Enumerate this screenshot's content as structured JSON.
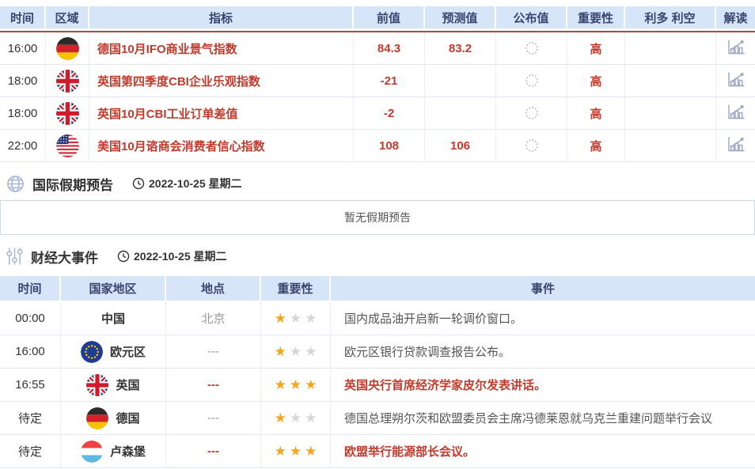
{
  "colors": {
    "accent_red": "#c23a2c",
    "header_bg": "#d7e5f8",
    "header_text": "#3b4470",
    "divider_red": "#a94a4a",
    "star_gold": "#f7a51d",
    "star_gray": "#d6d6d6"
  },
  "calendar_table": {
    "headers": [
      "时间",
      "区域",
      "指标",
      "前值",
      "预测值",
      "公布值",
      "重要性",
      "利多 利空",
      "解读"
    ],
    "rows": [
      {
        "time": "16:00",
        "flag": "germany",
        "indicator": "德国10月IFO商业景气指数",
        "previous": "84.3",
        "forecast": "83.2",
        "published": "",
        "importance": "高"
      },
      {
        "time": "18:00",
        "flag": "uk",
        "indicator": "英国第四季度CBI企业乐观指数",
        "previous": "-21",
        "forecast": "",
        "published": "",
        "importance": "高"
      },
      {
        "time": "18:00",
        "flag": "uk",
        "indicator": "英国10月CBI工业订单差值",
        "previous": "-2",
        "forecast": "",
        "published": "",
        "importance": "高"
      },
      {
        "time": "22:00",
        "flag": "usa",
        "indicator": "美国10月谘商会消费者信心指数",
        "previous": "108",
        "forecast": "106",
        "published": "",
        "importance": "高"
      }
    ]
  },
  "holiday_section": {
    "icon": "globe-icon",
    "title": "国际假期预告",
    "date_icon": "clock-icon",
    "date": "2022-10-25 星期二",
    "empty_message": "暂无假期预告"
  },
  "events_section": {
    "icon": "sliders-icon",
    "title": "财经大事件",
    "date_icon": "clock-icon",
    "date": "2022-10-25 星期二",
    "headers": [
      "时间",
      "国家地区",
      "地点",
      "重要性",
      "事件"
    ],
    "rows": [
      {
        "time": "00:00",
        "flag": "none",
        "country": "中国",
        "location": "北京",
        "stars": 1,
        "max_stars": 3,
        "event": "国内成品油开启新一轮调价窗口。",
        "highlight": false
      },
      {
        "time": "16:00",
        "flag": "eu",
        "country": "欧元区",
        "location": "---",
        "stars": 1,
        "max_stars": 3,
        "event": "欧元区银行贷款调查报告公布。",
        "highlight": false
      },
      {
        "time": "16:55",
        "flag": "uk",
        "country": "英国",
        "location": "---",
        "stars": 3,
        "max_stars": 3,
        "event": "英国央行首席经济学家皮尔发表讲话。",
        "highlight": true
      },
      {
        "time": "待定",
        "flag": "germany",
        "country": "德国",
        "location": "---",
        "stars": 1,
        "max_stars": 3,
        "event": "德国总理朔尔茨和欧盟委员会主席冯德莱恩就乌克兰重建问题举行会议",
        "highlight": false
      },
      {
        "time": "待定",
        "flag": "luxembourg",
        "country": "卢森堡",
        "location": "---",
        "stars": 3,
        "max_stars": 3,
        "event": "欧盟举行能源部长会议。",
        "highlight": true
      }
    ]
  },
  "icons": {
    "published_pending": "loading-spinner-icon",
    "interpretation": "bar-chart-icon"
  }
}
